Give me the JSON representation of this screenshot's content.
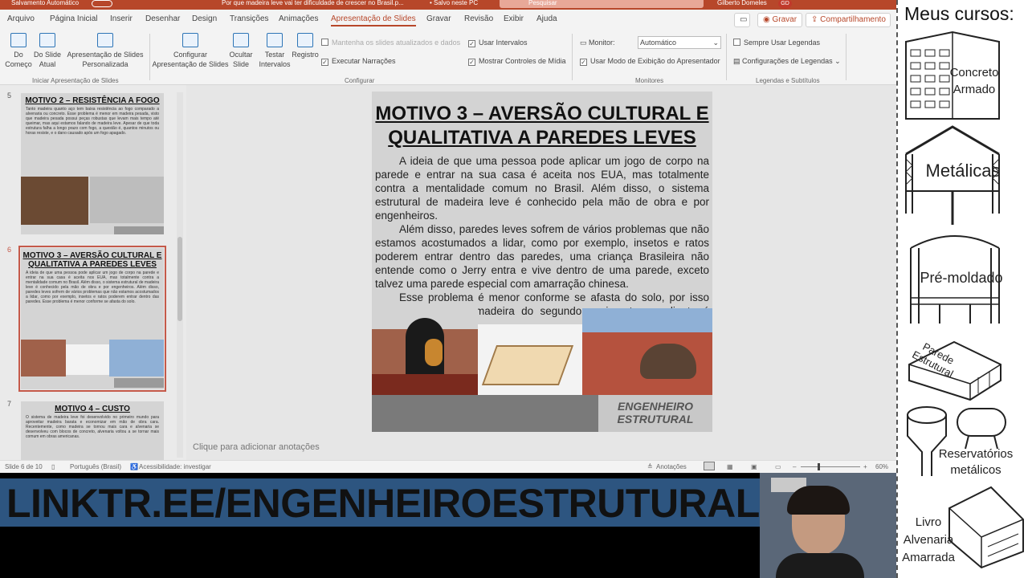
{
  "titlebar": {
    "autosave": "Salvamento Automático",
    "document": "Por que madeira leve vai ter dificuldade de crescer no Brasil.p...",
    "saved": "• Salvo neste PC",
    "search_placeholder": "Pesquisar",
    "user": "Gilberto Domeles",
    "initials": "GD"
  },
  "tabs": [
    "Arquivo",
    "Página Inicial",
    "Inserir",
    "Desenhar",
    "Design",
    "Transições",
    "Animações",
    "Apresentação de Slides",
    "Gravar",
    "Revisão",
    "Exibir",
    "Ajuda"
  ],
  "tab_buttons": {
    "record": "Gravar",
    "share": "Compartilhamento"
  },
  "ribbon": {
    "from_start": "Do\nComeço",
    "from_current": "Do Slide\nAtual",
    "custom_show": "Apresentação de Slides\nPersonalizada",
    "group_start": "Iniciar Apresentação de Slides",
    "setup": "Configurar\nApresentação de Slides",
    "hide_slide": "Ocultar\nSlide",
    "rehearse": "Testar\nIntervalos",
    "record": "Registro",
    "keep_updated": "Mantenha os slides atualizados e dados",
    "play_narrations": "Executar Narrações",
    "use_timings": "Usar Intervalos",
    "show_media": "Mostrar Controles de Mídia",
    "group_setup": "Configurar",
    "monitor_label": "Monitor:",
    "monitor_value": "Automático",
    "presenter_view": "Usar Modo de Exibição do Apresentador",
    "group_monitors": "Monitores",
    "always_captions": "Sempre Usar Legendas",
    "caption_settings": "Configurações de Legendas",
    "group_captions": "Legendas e Subtítulos"
  },
  "thumbnails": [
    {
      "num": "5",
      "title": "MOTIVO 2 – RESISTÊNCIA A FOGO",
      "text": "Tanto madeira quanto aço tem baixa resistência ao fogo comparado a alvenaria ou concreto. Esse problema é menor em madeira pesada, visto que madeira pesada possui peças robustas que levam mais tempo até queimar, mas aqui estamos falando de madeira leve. Apesar de que toda estrutura falha a longo prazo com fogo, a questão é, quantos minutos ou horas resiste, e o dano causado após um fogo apagado."
    },
    {
      "num": "6",
      "title": "MOTIVO 3 – AVERSÃO CULTURAL E QUALITATIVA A PAREDES LEVES",
      "text": "A ideia de que uma pessoa pode aplicar um jogo de corpo na parede e entrar na sua casa é aceita nos EUA, mas totalmente contra a mentalidade comum no Brasil. Além disso, o sistema estrutural de madeira leve é conhecido pela mão de obra e por engenheiros. Além disso, paredes leves sofrem de vários problemas que não estamos acostumados a lidar, como por exemplo, insetos e ratos poderem entrar dentro das paredes. Esse problema é menor conforme se afasta do solo."
    },
    {
      "num": "7",
      "title": "MOTIVO 4 – CUSTO",
      "text": "O sistema de madeira leve foi desenvolvido no primeiro mundo para aproveitar madeira barata e economizar em mão de obra cara. Recentemente, como madeira se tornou mais cara e alvenaria se desenvolveu com blocos de concreto, alvenaria voltou a se tornar mais comum em obras americanas."
    }
  ],
  "slide": {
    "title": "MOTIVO 3 – AVERSÃO CULTURAL E QUALITATIVA A PAREDES LEVES",
    "paragraphs": [
      "A ideia de que uma pessoa pode aplicar um jogo de corpo na parede e entrar na sua casa é aceita nos EUA, mas totalmente contra a mentalidade comum no Brasil. Além disso, o sistema estrutural de madeira leve é conhecido pela mão de obra e por engenheiros.",
      "Além disso, paredes leves sofrem de vários problemas que não estamos acostumados a lidar, como por exemplo, insetos e ratos poderem entrar dentro das paredes, uma criança Brasileira não entende como o Jerry entra e vive dentro de uma parede, exceto talvez uma parede especial com amarração chinesa.",
      "Esse problema é menor conforme se afasta do solo, por isso que o sistema de madeira do segundo pavimento em diante é comum."
    ],
    "logo": "ENGENHEIRO ESTRUTURAL"
  },
  "notes_placeholder": "Clique para adicionar anotações",
  "status": {
    "slide": "Slide 6 de 10",
    "language": "Português (Brasil)",
    "accessibility": "Acessibilidade: investigar",
    "notes": "Anotações",
    "zoom": "60%"
  },
  "banner": {
    "text": "LINKTR.EE/ENGENHEIROESTRUTURAL"
  },
  "courses": {
    "heading": "Meus cursos:",
    "items": [
      "Concreto\nArmado",
      "Metálicas",
      "Pré-moldado",
      "Parede\nEstrutural",
      "Reservatórios\nmetálicos",
      "Livro\nAlvenaria\nAmarrada"
    ]
  },
  "colors": {
    "accent": "#b7472a",
    "banner": "#2d5580"
  }
}
